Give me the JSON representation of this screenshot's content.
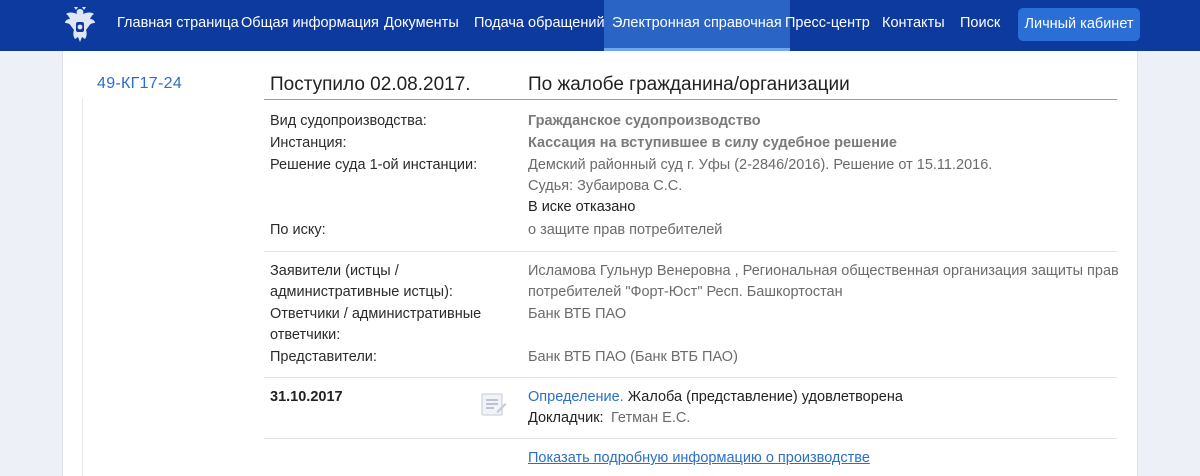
{
  "nav": {
    "items": [
      {
        "label": "Главная страница"
      },
      {
        "label": "Общая информация"
      },
      {
        "label": "Документы"
      },
      {
        "label": "Подача обращений"
      },
      {
        "label": "Электронная справочная",
        "active": true
      },
      {
        "label": "Пресс-центр"
      },
      {
        "label": "Контакты"
      },
      {
        "label": "Поиск"
      }
    ],
    "cabinet_label": "Личный кабинет",
    "emblem_icon": "coat-of-arms-icon"
  },
  "case": {
    "number": "49-КГ17-24",
    "received": "Поступило 02.08.2017.",
    "category": "По жалобе гражданина/организации"
  },
  "details": {
    "proceeding_type": {
      "label": "Вид судопроизводства:",
      "value": "Гражданское судопроизводство"
    },
    "instance": {
      "label": "Инстанция:",
      "value": "Кассация на вступившее в силу судебное решение"
    },
    "first_instance": {
      "label": "Решение суда 1-ой инстанции:",
      "court": "Демский районный суд г. Уфы (2-2846/2016).  Решение от 15.11.2016.",
      "judge": "Судья: Зубаирова С.С.",
      "result": "В иске отказано"
    },
    "claim": {
      "label": "По иску:",
      "value": "о защите прав потребителей"
    }
  },
  "parties": {
    "plaintiffs": {
      "label_line1": "Заявители (истцы /",
      "label_line2": "административные истцы):",
      "value_line1": "Исламова Гульнур Венеровна , Региональная общественная организация защиты прав",
      "value_line2": "потребителей \"Форт-Юст\" Респ. Башкортостан"
    },
    "defendants": {
      "label_line1": "Ответчики / административные",
      "label_line2": "ответчики:",
      "value": "Банк ВТБ ПАО"
    },
    "representatives": {
      "label": "Представители:",
      "value": "Банк ВТБ ПАО  (Банк ВТБ ПАО)"
    }
  },
  "event": {
    "date": "31.10.2017",
    "doc_link": "Определение.",
    "result": "Жалоба (представление) удовлетворена",
    "reporter_label": "Докладчик:",
    "reporter": "Гетман Е.С.",
    "doc_icon": "document-icon"
  },
  "more_link": "Показать подробную информацию о производстве",
  "colors": {
    "header": "#0c3a9f",
    "active_tab": "#2a65c6",
    "cabinet_button": "#2b6fd6",
    "link": "#2a6fc9"
  }
}
